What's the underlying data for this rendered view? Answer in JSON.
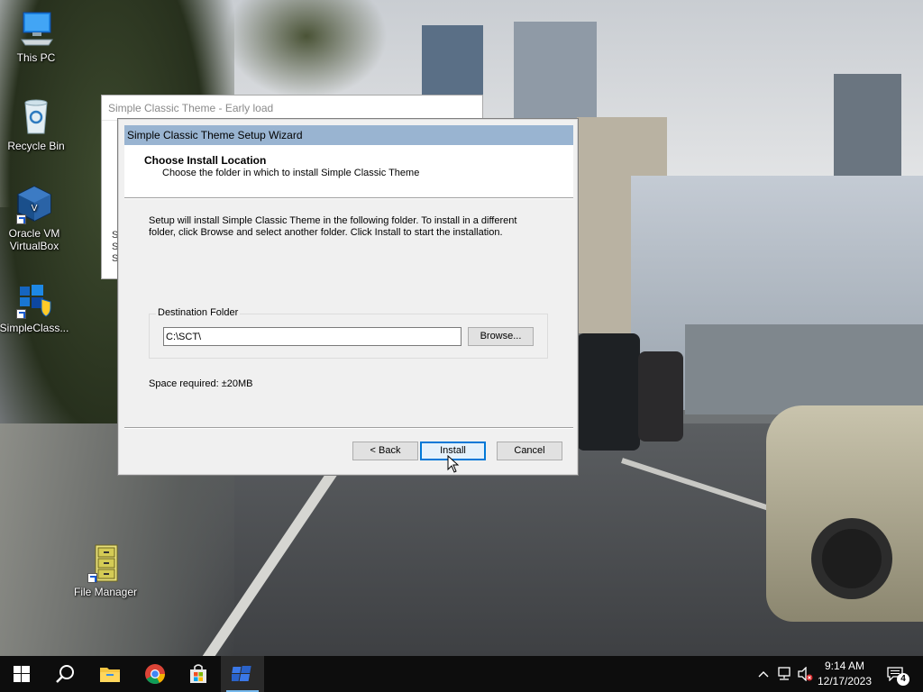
{
  "desktop": {
    "icons": [
      {
        "label": "This PC",
        "icon": "computer-icon"
      },
      {
        "label": "Recycle Bin",
        "icon": "recycle-bin-icon"
      },
      {
        "label": "Oracle VM VirtualBox",
        "icon": "virtualbox-icon"
      },
      {
        "label": "SimpleClass...",
        "icon": "windows-shield-icon"
      },
      {
        "label": "File Manager",
        "icon": "file-cabinet-icon"
      }
    ]
  },
  "background_window": {
    "title": "Simple Classic Theme - Early load",
    "lines": [
      "S",
      "S",
      "S"
    ]
  },
  "wizard": {
    "title": "Simple Classic Theme Setup Wizard",
    "header_title": "Choose Install Location",
    "header_subtitle": "Choose the folder in which to install Simple Classic Theme",
    "description": "Setup will install Simple Classic Theme in the following folder. To install in a different folder, click Browse and select another folder. Click Install to start the installation.",
    "destination_label": "Destination Folder",
    "destination_value": "C:\\SCT\\",
    "browse_label": "Browse...",
    "space_required": "Space required: ±20MB",
    "back_label": "< Back",
    "install_label": "Install",
    "cancel_label": "Cancel"
  },
  "taskbar": {
    "apps": [
      "start-icon",
      "search-icon",
      "file-explorer-icon",
      "chrome-icon",
      "store-icon",
      "simple-classic-theme-icon"
    ],
    "active_app": "simple-classic-theme-icon",
    "time": "9:14 AM",
    "date": "12/17/2023",
    "notification_count": "4"
  },
  "colors": {
    "wizard_titlebar": "#99b4d1",
    "dialog_face": "#f0f0f0",
    "taskbar": "#0d0d0d",
    "default_button_border": "#0078d7"
  }
}
